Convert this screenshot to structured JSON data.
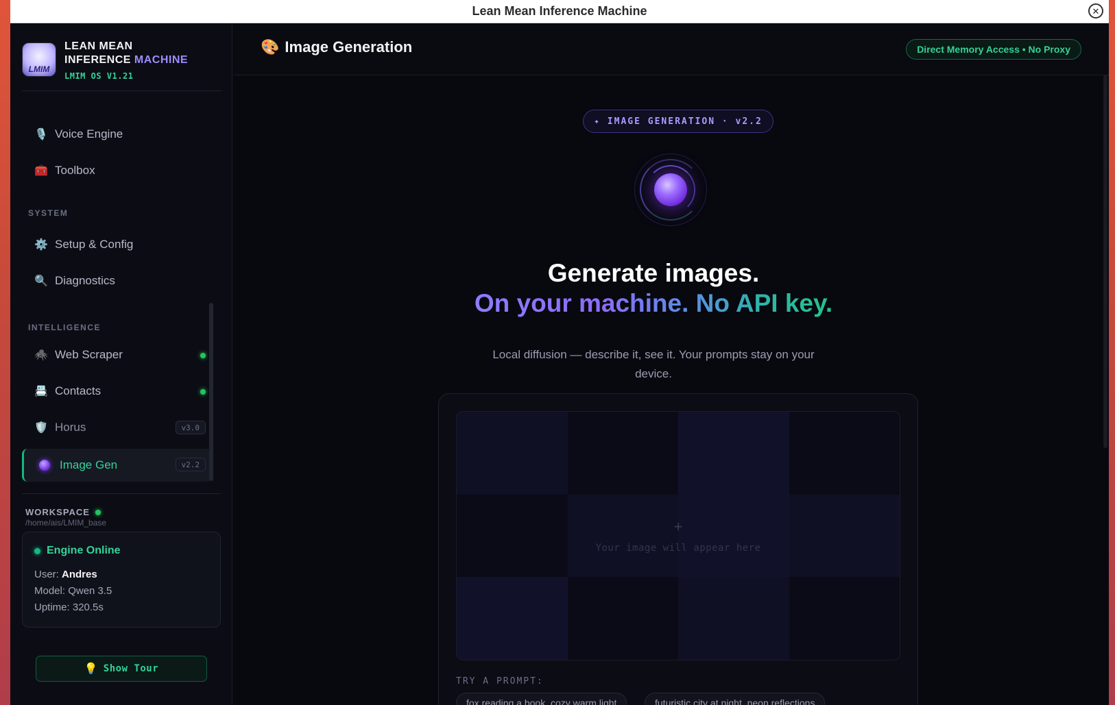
{
  "window": {
    "title": "Lean Mean Inference Machine",
    "close_symbol": "✕"
  },
  "brand": {
    "line1": "LEAN MEAN",
    "line2_a": "INFERENCE",
    "line2_b": "MACHINE",
    "version": "LMIM OS V1.21",
    "logo_text": "LMIM"
  },
  "sidebar": {
    "top_items": [
      {
        "icon": "🎙️",
        "label": "Voice Engine"
      },
      {
        "icon": "🧰",
        "label": "Toolbox"
      }
    ],
    "system_label": "SYSTEM",
    "system_items": [
      {
        "icon": "⚙️",
        "label": "Setup & Config"
      },
      {
        "icon": "🔍",
        "label": "Diagnostics"
      }
    ],
    "intelligence_label": "INTELLIGENCE",
    "intelligence_items": [
      {
        "icon": "🕷️",
        "label": "Web Scraper",
        "status": "online"
      },
      {
        "icon": "📇",
        "label": "Contacts",
        "status": "online"
      },
      {
        "icon": "🛡️",
        "label": "Horus",
        "badge": "v3.0"
      },
      {
        "label": "Image Gen",
        "badge": "v2.2",
        "active": true
      }
    ],
    "workspace": {
      "label": "WORKSPACE",
      "path": "/home/ais/LMIM_base"
    },
    "engine": {
      "status": "Engine Online",
      "user_label": "User:",
      "user": "Andres",
      "model": "Model: Qwen 3.5",
      "uptime": "Uptime: 320.5s"
    },
    "tour_button": {
      "icon": "💡",
      "label": "Show Tour"
    }
  },
  "main": {
    "title_icon": "🎨",
    "title": "Image Generation",
    "badge": "Direct Memory Access • No Proxy",
    "hero_badge": "✦ IMAGE GENERATION · v2.2",
    "headline1": "Generate images.",
    "headline2": "On your machine. No API key.",
    "subline": "Local diffusion — describe it, see it. Your prompts stay on your device.",
    "canvas": {
      "plus": "+",
      "placeholder": "Your image will appear here"
    },
    "try_label": "TRY A PROMPT:",
    "prompts": [
      "fox reading a book, cozy warm light",
      "futuristic city at night, neon reflections"
    ]
  }
}
